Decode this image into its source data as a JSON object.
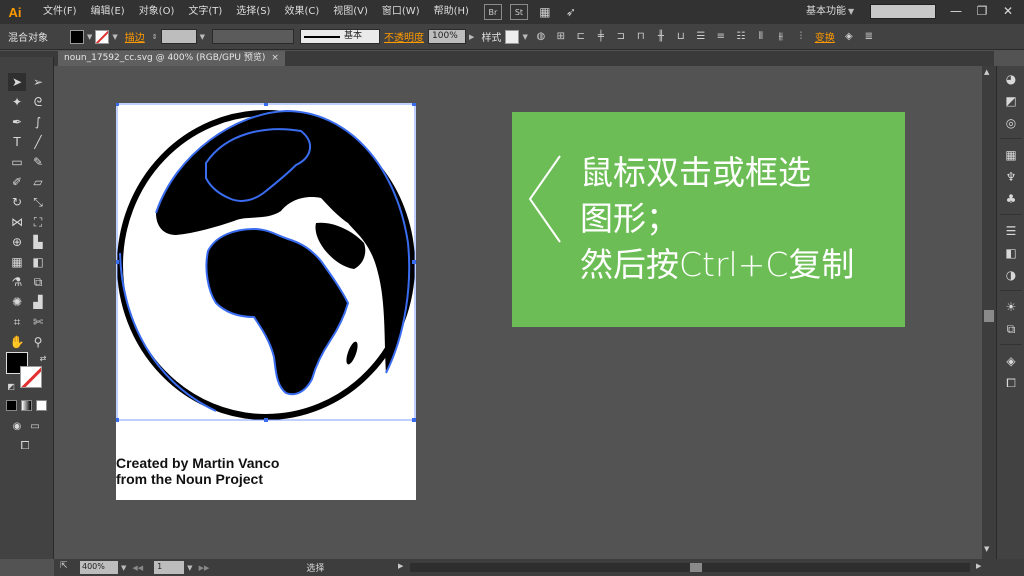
{
  "app": {
    "logo": "Ai",
    "menu": [
      "文件(F)",
      "编辑(E)",
      "对象(O)",
      "文字(T)",
      "选择(S)",
      "效果(C)",
      "视图(V)",
      "窗口(W)",
      "帮助(H)"
    ],
    "bridge_label": "Br",
    "stock_label": "St",
    "workspace": "基本功能",
    "search_placeholder": "",
    "window_controls": [
      "—",
      "❐",
      "✕"
    ]
  },
  "control_bar": {
    "selection_type": "混合对象",
    "stroke_label": "描边",
    "stroke_style": "基本",
    "opacity_label": "不透明度",
    "opacity_value": "100%",
    "style_label": "样式",
    "transform_label": "变换"
  },
  "document": {
    "tab_title": "noun_17592_cc.svg @ 400% (RGB/GPU 预览)",
    "tab_close": "×"
  },
  "artwork": {
    "credit_text": "Created by Martin Vanco\nfrom the Noun Project"
  },
  "callout": {
    "text": " 鼠标双击或框选\n图形；\n然后按Ctrl+C复制"
  },
  "status_bar": {
    "zoom": "400%",
    "artboard": "1",
    "current_tool": "选择"
  },
  "colors": {
    "callout_bg": "#6cbd55",
    "selection_blue": "#3a6cf0",
    "accent_orange": "#ff9a00"
  }
}
